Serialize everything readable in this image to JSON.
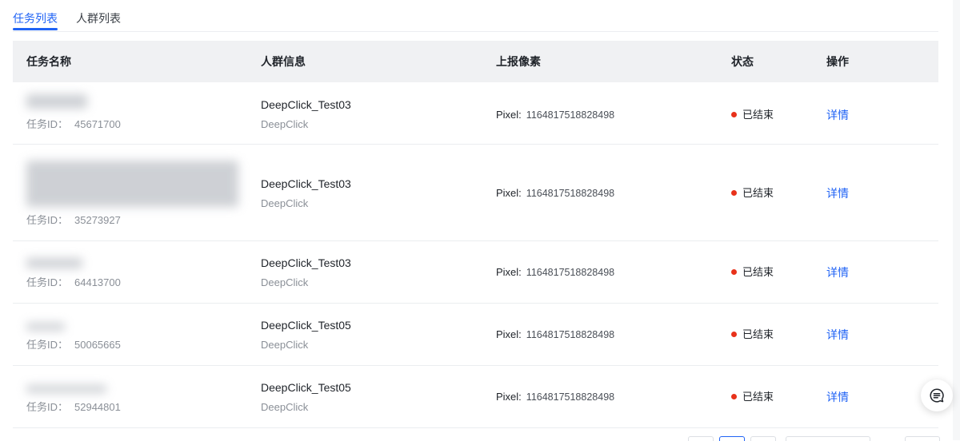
{
  "tabs": [
    {
      "label": "任务列表",
      "active": true
    },
    {
      "label": "人群列表",
      "active": false
    }
  ],
  "table": {
    "columns": {
      "task": "任务名称",
      "audience": "人群信息",
      "pixel": "上报像素",
      "status": "状态",
      "action": "操作"
    },
    "rows": [
      {
        "task_id_label": "任务ID：",
        "task_id": "45671700",
        "audience_name": "DeepClick_Test03",
        "audience_sub": "DeepClick",
        "pixel_label": "Pixel:",
        "pixel_id": "1164817518828498",
        "status": "已结束",
        "action": "详情"
      },
      {
        "task_id_label": "任务ID：",
        "task_id": "35273927",
        "audience_name": "DeepClick_Test03",
        "audience_sub": "DeepClick",
        "pixel_label": "Pixel:",
        "pixel_id": "1164817518828498",
        "status": "已结束",
        "action": "详情"
      },
      {
        "task_id_label": "任务ID：",
        "task_id": "64413700",
        "audience_name": "DeepClick_Test03",
        "audience_sub": "DeepClick",
        "pixel_label": "Pixel:",
        "pixel_id": "1164817518828498",
        "status": "已结束",
        "action": "详情"
      },
      {
        "task_id_label": "任务ID：",
        "task_id": "50065665",
        "audience_name": "DeepClick_Test05",
        "audience_sub": "DeepClick",
        "pixel_label": "Pixel:",
        "pixel_id": "1164817518828498",
        "status": "已结束",
        "action": "详情"
      },
      {
        "task_id_label": "任务ID：",
        "task_id": "52944801",
        "audience_name": "DeepClick_Test05",
        "audience_sub": "DeepClick",
        "pixel_label": "Pixel:",
        "pixel_id": "1164817518828498",
        "status": "已结束",
        "action": "详情"
      }
    ]
  },
  "colors": {
    "accent": "#2063f5",
    "status_ended": "#e8311a"
  },
  "icons": {
    "fab": "chat-icon"
  }
}
